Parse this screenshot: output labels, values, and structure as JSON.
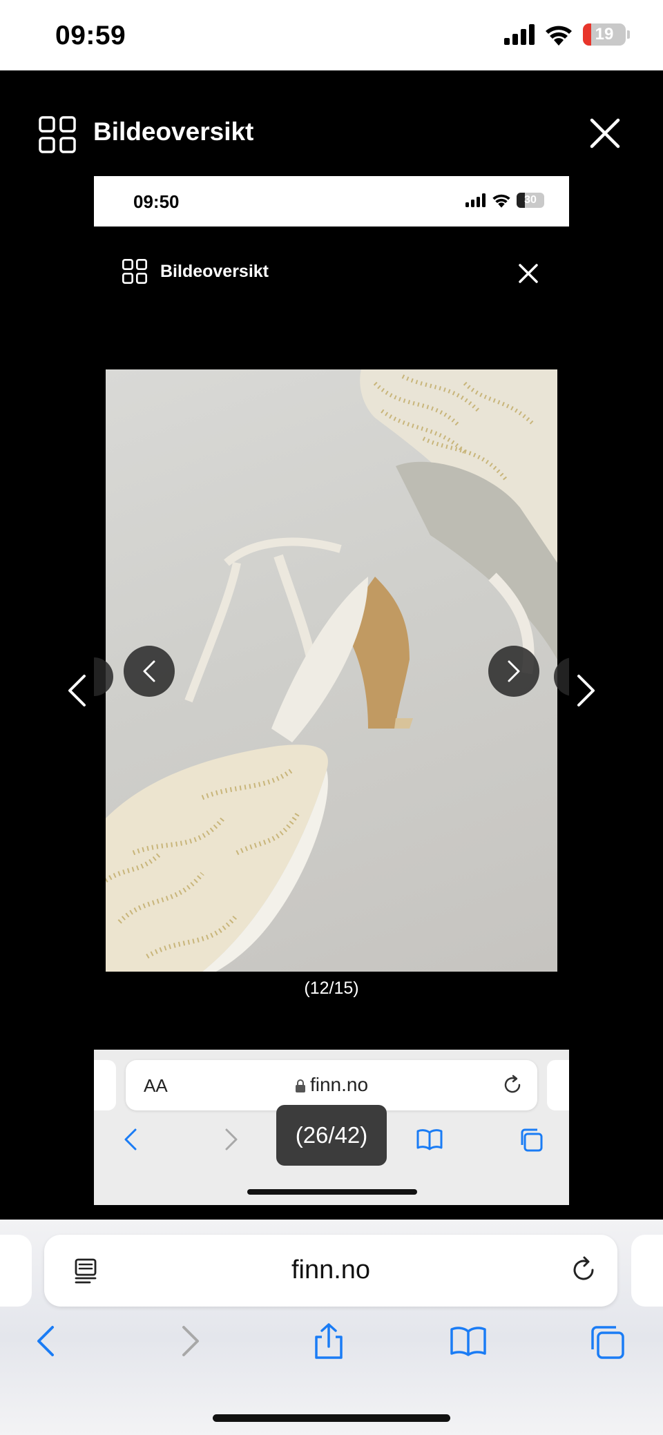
{
  "status_bar": {
    "time": "09:59",
    "battery_level": "19",
    "battery_color": "#e8352b"
  },
  "viewer": {
    "title": "Bildeoversikt"
  },
  "embedded_screenshot": {
    "status_bar": {
      "time": "09:50",
      "battery_level": "30"
    },
    "title": "Bildeoversikt",
    "image_counter": "(12/15)",
    "browser": {
      "text_size_label": "AA",
      "url": "finn.no"
    },
    "page_counter_toast": "(26/42)"
  },
  "browser": {
    "url": "finn.no",
    "accent": "#1a7cf5"
  },
  "icons": [
    "grid-icon",
    "close-icon",
    "chevron-left-icon",
    "chevron-right-icon",
    "reader-icon",
    "reload-icon",
    "share-icon",
    "bookmarks-icon",
    "tabs-icon",
    "lock-icon"
  ]
}
